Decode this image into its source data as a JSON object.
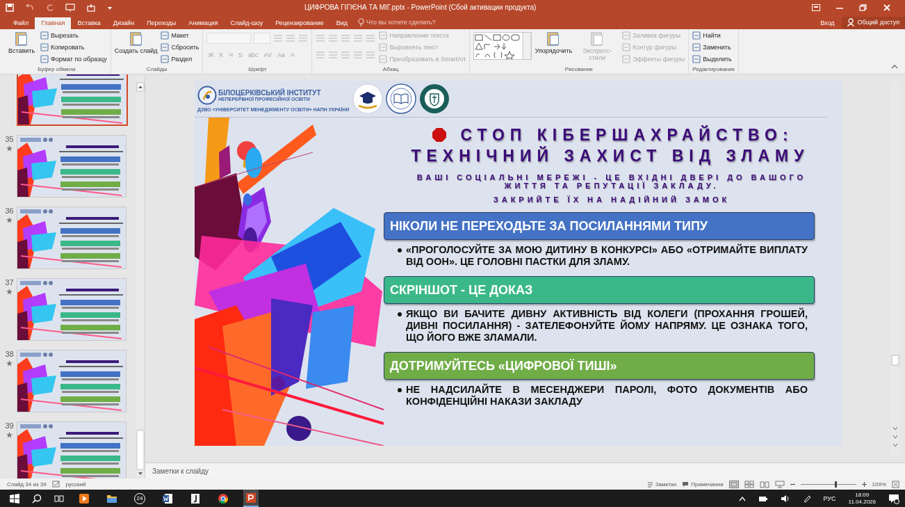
{
  "window": {
    "title": "ЦИФРОВА ГІГІЄНА ТА МІГ.pptx - PowerPoint (Сбой активации продукта)"
  },
  "ribbon_tabs": [
    {
      "label": "Файл",
      "selected": false
    },
    {
      "label": "Главная",
      "selected": true
    },
    {
      "label": "Вставка",
      "selected": false
    },
    {
      "label": "Дизайн",
      "selected": false
    },
    {
      "label": "Переходы",
      "selected": false
    },
    {
      "label": "Анимация",
      "selected": false
    },
    {
      "label": "Слайд-шоу",
      "selected": false
    },
    {
      "label": "Рецензирование",
      "selected": false
    },
    {
      "label": "Вид",
      "selected": false
    }
  ],
  "tell_me": {
    "placeholder": "Что вы хотите сделать?"
  },
  "account": {
    "sign_in": "Вход",
    "share": "Общий доступ"
  },
  "ribbon": {
    "groups": [
      {
        "label": "Буфер обмена",
        "columns": [
          [
            {
              "kind": "large",
              "label": "Вставить",
              "disabled": false
            }
          ],
          [
            {
              "kind": "small",
              "label": "Вырезать",
              "disabled": false
            },
            {
              "kind": "small",
              "label": "Копировать",
              "disabled": false
            },
            {
              "kind": "small",
              "label": "Формат по образцу",
              "disabled": false
            }
          ]
        ]
      },
      {
        "label": "Слайды",
        "columns": [
          [
            {
              "kind": "large",
              "label": "Создать слайд",
              "disabled": false
            }
          ],
          [
            {
              "kind": "small",
              "label": "Макет",
              "disabled": false
            },
            {
              "kind": "small",
              "label": "Сбросить",
              "disabled": false
            },
            {
              "kind": "small",
              "label": "Раздел",
              "disabled": false
            }
          ]
        ]
      },
      {
        "label": "Шрифт",
        "columns": [
          [
            {
              "kind": "row",
              "items": [
                {
                  "kind": "field",
                  "disabled": true
                },
                {
                  "kind": "field",
                  "disabled": true
                },
                {
                  "kind": "icon",
                  "disabled": true
                },
                {
                  "kind": "icon",
                  "disabled": true
                },
                {
                  "kind": "icon",
                  "disabled": true
                }
              ]
            },
            {
              "kind": "row",
              "items": [
                {
                  "kind": "glyph",
                  "label": "Ж",
                  "disabled": true
                },
                {
                  "kind": "glyph",
                  "label": "К",
                  "disabled": true
                },
                {
                  "kind": "glyph",
                  "label": "Ч",
                  "disabled": true
                },
                {
                  "kind": "glyph",
                  "label": "S",
                  "disabled": true
                },
                {
                  "kind": "glyph",
                  "label": "abc",
                  "disabled": true
                },
                {
                  "kind": "glyph",
                  "label": "AV",
                  "disabled": true
                },
                {
                  "kind": "glyph",
                  "label": "Aa",
                  "disabled": true
                },
                {
                  "kind": "glyph",
                  "label": "A",
                  "disabled": true
                }
              ]
            }
          ]
        ]
      },
      {
        "label": "Абзац",
        "columns": [
          [
            {
              "kind": "row",
              "items": [
                {
                  "kind": "icon",
                  "disabled": true
                },
                {
                  "kind": "icon",
                  "disabled": true
                },
                {
                  "kind": "icon",
                  "disabled": true
                },
                {
                  "kind": "icon",
                  "disabled": true
                },
                {
                  "kind": "icon",
                  "disabled": true
                }
              ]
            },
            {
              "kind": "row",
              "items": [
                {
                  "kind": "icon",
                  "disabled": true
                },
                {
                  "kind": "icon",
                  "disabled": true
                },
                {
                  "kind": "icon",
                  "disabled": true
                },
                {
                  "kind": "icon",
                  "disabled": true
                },
                {
                  "kind": "icon",
                  "disabled": true
                }
              ]
            }
          ],
          [
            {
              "kind": "small",
              "label": "Направление текста",
              "disabled": true
            },
            {
              "kind": "small",
              "label": "Выровнять текст",
              "disabled": true
            },
            {
              "kind": "small",
              "label": "Преобразовать в SmartArt",
              "disabled": true
            }
          ]
        ]
      },
      {
        "label": "Рисование",
        "columns": [
          [
            {
              "kind": "gallery"
            }
          ],
          [
            {
              "kind": "large",
              "label": "Упорядочить",
              "disabled": false
            }
          ],
          [
            {
              "kind": "large",
              "label": "Экспресс-стили",
              "disabled": true
            }
          ],
          [
            {
              "kind": "small",
              "label": "Заливка фигуры",
              "disabled": true
            },
            {
              "kind": "small",
              "label": "Контур фигуры",
              "disabled": true
            },
            {
              "kind": "small",
              "label": "Эффекты фигуры",
              "disabled": true
            }
          ]
        ]
      },
      {
        "label": "Редактирование",
        "columns": [
          [
            {
              "kind": "small",
              "label": "Найти",
              "disabled": false
            },
            {
              "kind": "small",
              "label": "Заменить",
              "disabled": false
            },
            {
              "kind": "small",
              "label": "Выделить",
              "disabled": false
            }
          ]
        ]
      }
    ]
  },
  "thumbnails": [
    {
      "selected": true
    },
    {
      "number": "35",
      "selected": false
    },
    {
      "number": "36",
      "selected": false
    },
    {
      "number": "37",
      "selected": false
    },
    {
      "number": "38",
      "selected": false
    },
    {
      "number": "39",
      "selected": false
    }
  ],
  "slide": {
    "institute": {
      "name_line_1": "БІЛОЦЕРКІВСЬКИЙ ІНСТИТУТ",
      "name_line_2": "НЕПЕРЕРВНОЇ ПРОФЕСІЙНОЇ ОСВІТИ",
      "parent": "ДЗВО «УНІВЕРСИТЕТ МЕНЕДЖМЕНТУ ОСВІТИ» НАПН УКРАЇНИ"
    },
    "title_line_1": "СТОП КІБЕРШАХРАЙСТВО:",
    "title_line_2": "ТЕХНІЧНИЙ ЗАХИСТ ВІД ЗЛАМУ",
    "subtitle": "ВАШІ СОЦІАЛЬНІ МЕРЕЖІ - ЦЕ ВХІДНІ ДВЕРІ ДО ВАШОГО ЖИТТЯ ТА РЕПУТАЦІЇ ЗАКЛАДУ.",
    "subtitle_2": "ЗАКРИЙТЕ ЇХ НА НАДІЙНИЙ ЗАМОК",
    "sections": [
      {
        "heading": "НІКОЛИ НЕ ПЕРЕХОДЬТЕ ЗА ПОСИЛАННЯМИ ТИПУ",
        "color": "#4472c4",
        "bullet": "«ПРОГОЛОСУЙТЕ ЗА МОЮ ДИТИНУ В КОНКУРСІ» АБО «ОТРИМАЙТЕ ВИПЛАТУ ВІД ООН». ЦЕ ГОЛОВНІ ПАСТКИ ДЛЯ ЗЛАМУ."
      },
      {
        "heading": "СКРІНШОТ  - ЦЕ ДОКАЗ",
        "color": "#3bb88a",
        "bullet": "ЯКЩО ВИ БАЧИТЕ ДИВНУ АКТИВНІСТЬ ВІД КОЛЕГИ (ПРОХАННЯ ГРОШЕЙ, ДИВНІ ПОСИЛАННЯ) - ЗАТЕЛЕФОНУЙТЕ ЙОМУ НАПРЯМУ. ЦЕ ОЗНАКА ТОГО, ЩО ЙОГО ВЖЕ ЗЛАМАЛИ."
      },
      {
        "heading": "ДОТРИМУЙТЕСЬ «ЦИФРОВОЇ ТИШІ»",
        "color": "#70ad47",
        "bullet": "НЕ НАДСИЛАЙТЕ В МЕСЕНДЖЕРИ ПАРОЛІ, ФОТО ДОКУМЕНТІВ АБО КОНФІДЕНЦІЙНІ НАКАЗИ ЗАКЛАДУ"
      }
    ]
  },
  "notes": {
    "placeholder": "Заметки к слайду"
  },
  "status_bar": {
    "slide_info": "Слайд 34 из 39",
    "language": "русский",
    "notes": "Заметки",
    "comments": "Примечания",
    "zoom_level": {
      "level": 0.62
    },
    "zoom_reading": "109%"
  },
  "taskbar": {
    "apps": [
      {
        "kind": "media",
        "active": false
      },
      {
        "kind": "folder",
        "active": false
      },
      {
        "kind": "counter",
        "label": "24",
        "active": false
      },
      {
        "kind": "word",
        "active": false
      },
      {
        "kind": "journal",
        "active": false
      },
      {
        "kind": "chrome",
        "active": false
      },
      {
        "kind": "powerpoint",
        "active": true
      }
    ],
    "language": "РУС",
    "time": "18:09",
    "date": "11.04.2026"
  }
}
